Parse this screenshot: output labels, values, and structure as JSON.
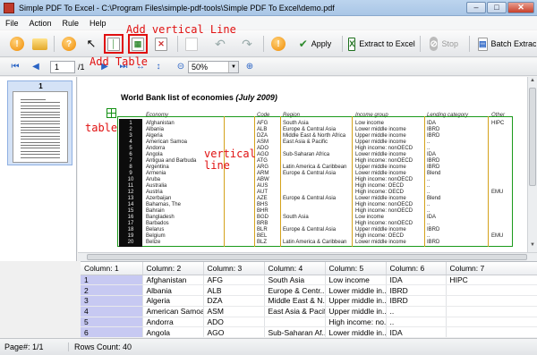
{
  "window": {
    "title": "Simple PDF To Excel - C:\\Program Files\\simple-pdf-tools\\Simple PDF To Excel\\demo.pdf",
    "min": "–",
    "max": "□",
    "close": "✕"
  },
  "menu": [
    "File",
    "Action",
    "Rule",
    "Help"
  ],
  "toolbar": {
    "apply": "Apply",
    "extract": "Extract to Excel",
    "stop": "Stop",
    "batch": "Batch Extract"
  },
  "nav": {
    "page": "1",
    "total": "/1",
    "zoom": "50%"
  },
  "thumbnail": {
    "page_number": "1"
  },
  "annotations": {
    "add_vertical_line": "Add vertical Line",
    "add_table": "Add Table",
    "table": "table",
    "vertical_line": "vertical\nline"
  },
  "document": {
    "title": "World Bank list of economies",
    "title_date": "(July 2009)",
    "headers": {
      "economy": "Economy",
      "code": "Code",
      "region": "Region",
      "income": "Income group",
      "lending": "Lending category",
      "other": "Other"
    },
    "rows": [
      {
        "n": "1",
        "economy": "Afghanistan",
        "code": "AFG",
        "region": "South Asia",
        "income": "Low income",
        "lending": "IDA",
        "other": "HIPC"
      },
      {
        "n": "2",
        "economy": "Albania",
        "code": "ALB",
        "region": "Europe & Central Asia",
        "income": "Lower middle income",
        "lending": "IBRD",
        "other": ""
      },
      {
        "n": "3",
        "economy": "Algeria",
        "code": "DZA",
        "region": "Middle East & North Africa",
        "income": "Upper middle income",
        "lending": "IBRD",
        "other": ""
      },
      {
        "n": "4",
        "economy": "American Samoa",
        "code": "ASM",
        "region": "East Asia & Pacific",
        "income": "Upper middle income",
        "lending": "..",
        "other": ""
      },
      {
        "n": "5",
        "economy": "Andorra",
        "code": "ADO",
        "region": "",
        "income": "High income: nonOECD",
        "lending": "..",
        "other": ""
      },
      {
        "n": "6",
        "economy": "Angola",
        "code": "AGO",
        "region": "Sub-Saharan Africa",
        "income": "Lower middle income",
        "lending": "IDA",
        "other": ""
      },
      {
        "n": "7",
        "economy": "Antigua and Barbuda",
        "code": "ATG",
        "region": "",
        "income": "High income: nonOECD",
        "lending": "IBRD",
        "other": ""
      },
      {
        "n": "8",
        "economy": "Argentina",
        "code": "ARG",
        "region": "Latin America & Caribbean",
        "income": "Upper middle income",
        "lending": "IBRD",
        "other": ""
      },
      {
        "n": "9",
        "economy": "Armenia",
        "code": "ARM",
        "region": "Europe & Central Asia",
        "income": "Lower middle income",
        "lending": "Blend",
        "other": ""
      },
      {
        "n": "10",
        "economy": "Aruba",
        "code": "ABW",
        "region": "",
        "income": "High income: nonOECD",
        "lending": "..",
        "other": ""
      },
      {
        "n": "11",
        "economy": "Australia",
        "code": "AUS",
        "region": "",
        "income": "High income: OECD",
        "lending": "..",
        "other": ""
      },
      {
        "n": "12",
        "economy": "Austria",
        "code": "AUT",
        "region": "",
        "income": "High income: OECD",
        "lending": "..",
        "other": "EMU"
      },
      {
        "n": "13",
        "economy": "Azerbaijan",
        "code": "AZE",
        "region": "Europe & Central Asia",
        "income": "Lower middle income",
        "lending": "Blend",
        "other": ""
      },
      {
        "n": "14",
        "economy": "Bahamas, The",
        "code": "BHS",
        "region": "",
        "income": "High income: nonOECD",
        "lending": "..",
        "other": ""
      },
      {
        "n": "15",
        "economy": "Bahrain",
        "code": "BHR",
        "region": "",
        "income": "High income: nonOECD",
        "lending": "..",
        "other": ""
      },
      {
        "n": "16",
        "economy": "Bangladesh",
        "code": "BGD",
        "region": "South Asia",
        "income": "Low income",
        "lending": "IDA",
        "other": ""
      },
      {
        "n": "17",
        "economy": "Barbados",
        "code": "BRB",
        "region": "",
        "income": "High income: nonOECD",
        "lending": "..",
        "other": ""
      },
      {
        "n": "18",
        "economy": "Belarus",
        "code": "BLR",
        "region": "Europe & Central Asia",
        "income": "Upper middle income",
        "lending": "IBRD",
        "other": ""
      },
      {
        "n": "19",
        "economy": "Belgium",
        "code": "BEL",
        "region": "",
        "income": "High income: OECD",
        "lending": "..",
        "other": "EMU"
      },
      {
        "n": "20",
        "economy": "Belize",
        "code": "BLZ",
        "region": "Latin America & Caribbean",
        "income": "Lower middle income",
        "lending": "IBRD",
        "other": ""
      }
    ]
  },
  "grid": {
    "columns": [
      "Column: 1",
      "Column: 2",
      "Column: 3",
      "Column: 4",
      "Column: 5",
      "Column: 6",
      "Column: 7"
    ],
    "rows": [
      [
        "1",
        "Afghanistan",
        "AFG",
        "South Asia",
        "Low income",
        "IDA",
        "HIPC"
      ],
      [
        "2",
        "Albania",
        "ALB",
        "Europe & Centr...",
        "Lower middle in...",
        "IBRD",
        ""
      ],
      [
        "3",
        "Algeria",
        "DZA",
        "Middle East & N...",
        "Upper middle in...",
        "IBRD",
        ""
      ],
      [
        "4",
        "American Samoa",
        "ASM",
        "East Asia & Pacific",
        "Upper middle in...",
        "..",
        ""
      ],
      [
        "5",
        "Andorra",
        "ADO",
        "",
        "High income: no...",
        "..",
        ""
      ],
      [
        "6",
        "Angola",
        "AGO",
        "Sub-Saharan Af...",
        "Lower middle in...",
        "IDA",
        ""
      ]
    ]
  },
  "status": {
    "page": "Page#: 1/1",
    "rows": "Rows Count: 40"
  }
}
